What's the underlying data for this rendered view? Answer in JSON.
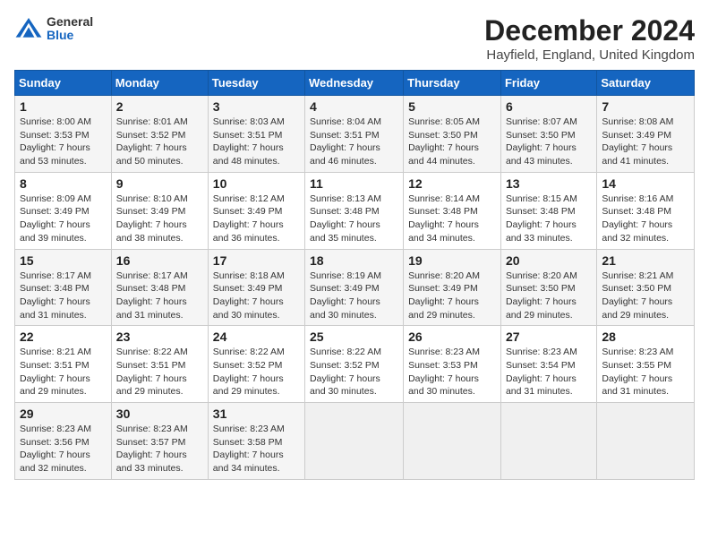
{
  "header": {
    "logo_general": "General",
    "logo_blue": "Blue",
    "title": "December 2024",
    "location": "Hayfield, England, United Kingdom"
  },
  "calendar": {
    "columns": [
      "Sunday",
      "Monday",
      "Tuesday",
      "Wednesday",
      "Thursday",
      "Friday",
      "Saturday"
    ],
    "rows": [
      [
        {
          "day": "1",
          "sunrise": "8:00 AM",
          "sunset": "3:53 PM",
          "daylight": "7 hours and 53 minutes."
        },
        {
          "day": "2",
          "sunrise": "8:01 AM",
          "sunset": "3:52 PM",
          "daylight": "7 hours and 50 minutes."
        },
        {
          "day": "3",
          "sunrise": "8:03 AM",
          "sunset": "3:51 PM",
          "daylight": "7 hours and 48 minutes."
        },
        {
          "day": "4",
          "sunrise": "8:04 AM",
          "sunset": "3:51 PM",
          "daylight": "7 hours and 46 minutes."
        },
        {
          "day": "5",
          "sunrise": "8:05 AM",
          "sunset": "3:50 PM",
          "daylight": "7 hours and 44 minutes."
        },
        {
          "day": "6",
          "sunrise": "8:07 AM",
          "sunset": "3:50 PM",
          "daylight": "7 hours and 43 minutes."
        },
        {
          "day": "7",
          "sunrise": "8:08 AM",
          "sunset": "3:49 PM",
          "daylight": "7 hours and 41 minutes."
        }
      ],
      [
        {
          "day": "8",
          "sunrise": "8:09 AM",
          "sunset": "3:49 PM",
          "daylight": "7 hours and 39 minutes."
        },
        {
          "day": "9",
          "sunrise": "8:10 AM",
          "sunset": "3:49 PM",
          "daylight": "7 hours and 38 minutes."
        },
        {
          "day": "10",
          "sunrise": "8:12 AM",
          "sunset": "3:49 PM",
          "daylight": "7 hours and 36 minutes."
        },
        {
          "day": "11",
          "sunrise": "8:13 AM",
          "sunset": "3:48 PM",
          "daylight": "7 hours and 35 minutes."
        },
        {
          "day": "12",
          "sunrise": "8:14 AM",
          "sunset": "3:48 PM",
          "daylight": "7 hours and 34 minutes."
        },
        {
          "day": "13",
          "sunrise": "8:15 AM",
          "sunset": "3:48 PM",
          "daylight": "7 hours and 33 minutes."
        },
        {
          "day": "14",
          "sunrise": "8:16 AM",
          "sunset": "3:48 PM",
          "daylight": "7 hours and 32 minutes."
        }
      ],
      [
        {
          "day": "15",
          "sunrise": "8:17 AM",
          "sunset": "3:48 PM",
          "daylight": "7 hours and 31 minutes."
        },
        {
          "day": "16",
          "sunrise": "8:17 AM",
          "sunset": "3:48 PM",
          "daylight": "7 hours and 31 minutes."
        },
        {
          "day": "17",
          "sunrise": "8:18 AM",
          "sunset": "3:49 PM",
          "daylight": "7 hours and 30 minutes."
        },
        {
          "day": "18",
          "sunrise": "8:19 AM",
          "sunset": "3:49 PM",
          "daylight": "7 hours and 30 minutes."
        },
        {
          "day": "19",
          "sunrise": "8:20 AM",
          "sunset": "3:49 PM",
          "daylight": "7 hours and 29 minutes."
        },
        {
          "day": "20",
          "sunrise": "8:20 AM",
          "sunset": "3:50 PM",
          "daylight": "7 hours and 29 minutes."
        },
        {
          "day": "21",
          "sunrise": "8:21 AM",
          "sunset": "3:50 PM",
          "daylight": "7 hours and 29 minutes."
        }
      ],
      [
        {
          "day": "22",
          "sunrise": "8:21 AM",
          "sunset": "3:51 PM",
          "daylight": "7 hours and 29 minutes."
        },
        {
          "day": "23",
          "sunrise": "8:22 AM",
          "sunset": "3:51 PM",
          "daylight": "7 hours and 29 minutes."
        },
        {
          "day": "24",
          "sunrise": "8:22 AM",
          "sunset": "3:52 PM",
          "daylight": "7 hours and 29 minutes."
        },
        {
          "day": "25",
          "sunrise": "8:22 AM",
          "sunset": "3:52 PM",
          "daylight": "7 hours and 30 minutes."
        },
        {
          "day": "26",
          "sunrise": "8:23 AM",
          "sunset": "3:53 PM",
          "daylight": "7 hours and 30 minutes."
        },
        {
          "day": "27",
          "sunrise": "8:23 AM",
          "sunset": "3:54 PM",
          "daylight": "7 hours and 31 minutes."
        },
        {
          "day": "28",
          "sunrise": "8:23 AM",
          "sunset": "3:55 PM",
          "daylight": "7 hours and 31 minutes."
        }
      ],
      [
        {
          "day": "29",
          "sunrise": "8:23 AM",
          "sunset": "3:56 PM",
          "daylight": "7 hours and 32 minutes."
        },
        {
          "day": "30",
          "sunrise": "8:23 AM",
          "sunset": "3:57 PM",
          "daylight": "7 hours and 33 minutes."
        },
        {
          "day": "31",
          "sunrise": "8:23 AM",
          "sunset": "3:58 PM",
          "daylight": "7 hours and 34 minutes."
        },
        null,
        null,
        null,
        null
      ]
    ]
  }
}
